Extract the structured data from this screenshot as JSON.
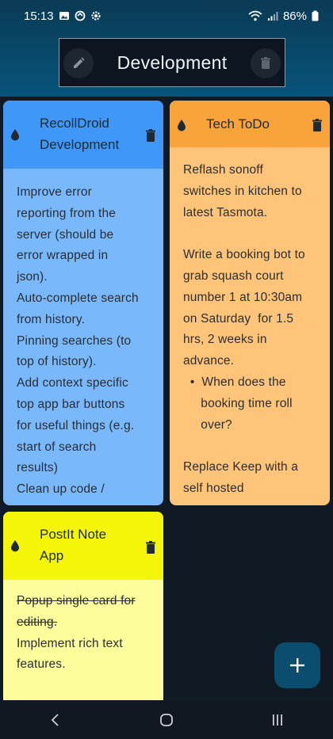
{
  "status": {
    "time": "15:13",
    "battery": "86%"
  },
  "header": {
    "title": "Development"
  },
  "cards": [
    {
      "title_lines": [
        "RecollDroid",
        "Development"
      ],
      "color": "#3f98f8",
      "body_color": "#79b8fb",
      "lines": [
        "Improve error",
        "reporting from the",
        "server (should be",
        "error wrapped in",
        "json).",
        "Auto-complete search",
        "from history.",
        "Pinning searches (to",
        "top of history).",
        "Add context specific",
        "top app bar buttons",
        "for useful things (e.g.",
        "start of search",
        "results)",
        "Clean up code /"
      ]
    },
    {
      "title_lines": [
        "Tech ToDo"
      ],
      "color": "#f9a43b",
      "body_color": "#fdc47a",
      "lines": [
        "Reflash sonoff",
        "switches in kitchen to",
        "latest Tasmota.",
        "",
        "Write a booking bot to",
        "grab squash court",
        "number 1 at 10:30am",
        "on Saturday  for 1.5",
        "hrs, 2 weeks in",
        "advance.",
        "  •  When does the",
        "     booking time roll",
        "     over?",
        "",
        "Replace Keep with a",
        "self hosted"
      ]
    },
    {
      "title_lines": [
        "PostIt Note",
        "App"
      ],
      "color": "#f5f50a",
      "body_color": "#fdfd9b",
      "struck_lines": [
        "Popup single card for",
        "editing."
      ],
      "lines": [
        "Implement rich text",
        "features."
      ]
    }
  ]
}
